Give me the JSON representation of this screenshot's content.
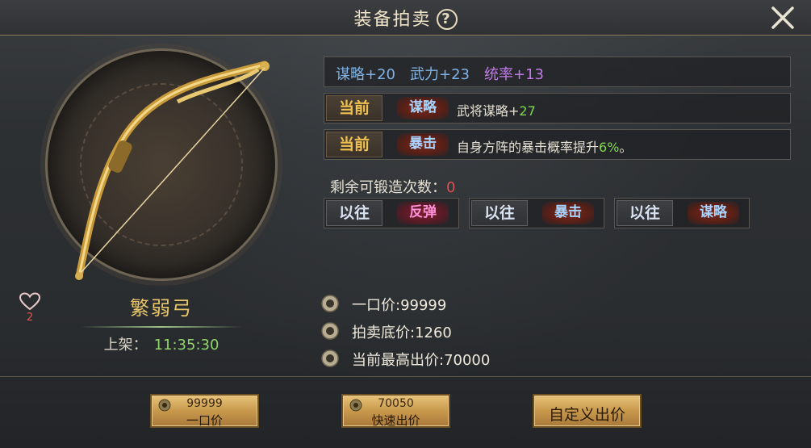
{
  "header": {
    "title": "装备拍卖",
    "help_icon": "?"
  },
  "item": {
    "name": "繁弱弓",
    "favorite_count": "2",
    "listed_label": "上架：",
    "listed_time": "11:35:30"
  },
  "stats": {
    "s1": "谋略+20",
    "s2": "武力+23",
    "s3": "统率+13"
  },
  "current_effects": [
    {
      "tag": "当前",
      "skill": "谋略",
      "desc_prefix": "武将谋略+",
      "desc_value": "27",
      "desc_suffix": ""
    },
    {
      "tag": "当前",
      "skill": "暴击",
      "desc_prefix": "自身方阵的暴击概率提升",
      "desc_value": "6%",
      "desc_suffix": "。"
    }
  ],
  "forge": {
    "label": "剩余可锻造次数：",
    "count": "0"
  },
  "past_effects": [
    {
      "tag": "以往",
      "skill": "反弹"
    },
    {
      "tag": "以往",
      "skill": "暴击"
    },
    {
      "tag": "以往",
      "skill": "谋略"
    }
  ],
  "prices": {
    "buyout": "一口价:99999",
    "reserve": "拍卖底价:1260",
    "highest_bid": "当前最高出价:70000"
  },
  "buttons": {
    "buyout": {
      "amount": "99999",
      "label": "一口价"
    },
    "quick_bid": {
      "amount": "70050",
      "label": "快速出价"
    },
    "custom_bid": {
      "label": "自定义出价"
    }
  },
  "colors": {
    "gold_text": "#e8c46a",
    "stat_blue": "#7fb3e8",
    "stat_purple": "#c07ae8",
    "positive_green": "#7fd84f",
    "warning_red": "#e05050"
  }
}
